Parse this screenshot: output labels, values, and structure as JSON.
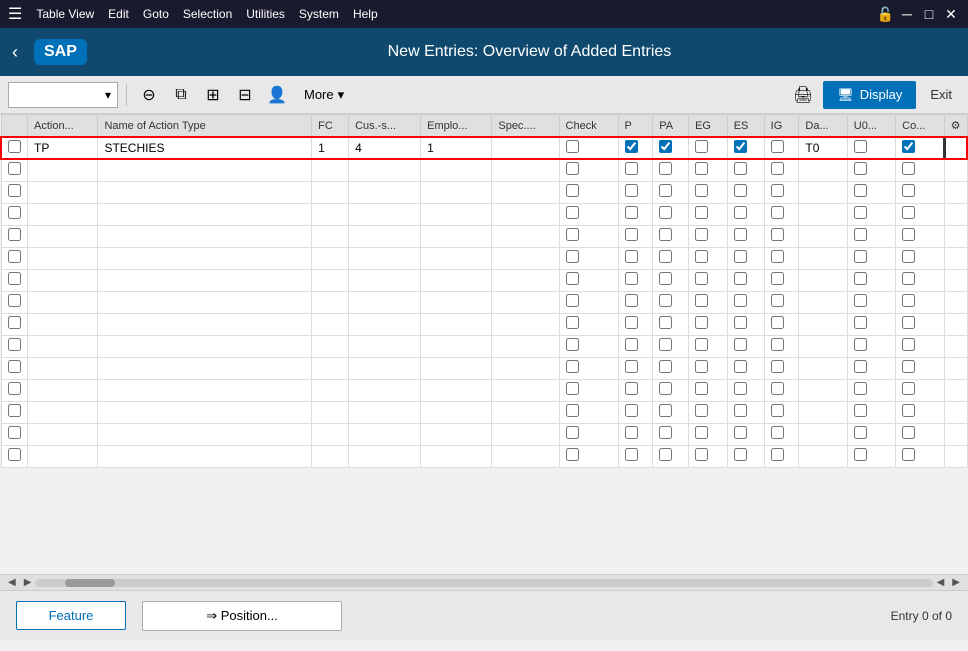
{
  "titlebar": {
    "menu_items": [
      "Table View",
      "Edit",
      "Goto",
      "Selection",
      "Utilities",
      "System",
      "Help"
    ]
  },
  "header": {
    "title": "New Entries: Overview of Added Entries",
    "back_label": "‹",
    "sap_label": "SAP"
  },
  "toolbar": {
    "dropdown_placeholder": "",
    "more_label": "More",
    "display_label": "Display",
    "exit_label": "Exit"
  },
  "table": {
    "settings_icon": "⚙",
    "columns": [
      {
        "key": "select",
        "label": ""
      },
      {
        "key": "action",
        "label": "Action..."
      },
      {
        "key": "name",
        "label": "Name of Action Type"
      },
      {
        "key": "fc",
        "label": "FC"
      },
      {
        "key": "cus_s",
        "label": "Cus.-s..."
      },
      {
        "key": "emplo",
        "label": "Emplo..."
      },
      {
        "key": "spec",
        "label": "Spec...."
      },
      {
        "key": "check",
        "label": "Check"
      },
      {
        "key": "p",
        "label": "P"
      },
      {
        "key": "pa",
        "label": "PA"
      },
      {
        "key": "eg",
        "label": "EG"
      },
      {
        "key": "es",
        "label": "ES"
      },
      {
        "key": "ig",
        "label": "IG"
      },
      {
        "key": "da",
        "label": "Da..."
      },
      {
        "key": "u0",
        "label": "U0..."
      },
      {
        "key": "co",
        "label": "Co..."
      },
      {
        "key": "settings",
        "label": "⚙"
      }
    ],
    "rows": [
      {
        "select": false,
        "action": "TP",
        "name": "STECHIES",
        "fc": "1",
        "cus_s": "4",
        "emplo": "1",
        "spec": "",
        "check": false,
        "p": true,
        "pa": true,
        "eg": false,
        "es": true,
        "ig": false,
        "da": "T0",
        "u0": false,
        "co": true,
        "is_selected": true,
        "cursor_on_co": true
      }
    ],
    "empty_rows": 15
  },
  "bottom": {
    "feature_label": "Feature",
    "position_label": "⇒ Position...",
    "entry_info": "Entry 0 of 0"
  }
}
